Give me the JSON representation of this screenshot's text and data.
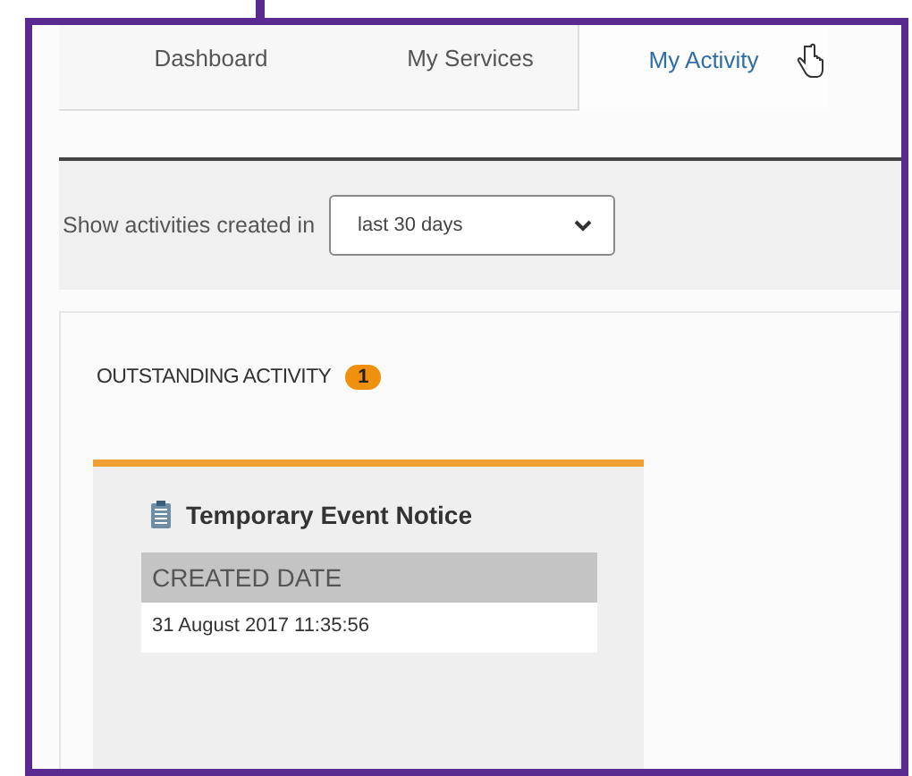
{
  "tabs": [
    {
      "label": "Dashboard",
      "selected": false
    },
    {
      "label": "My Services",
      "selected": false
    },
    {
      "label": "My Activity",
      "selected": true
    }
  ],
  "filter": {
    "label": "Show activities created in",
    "value": "last 30 days"
  },
  "section": {
    "title": "OUTSTANDING ACTIVITY",
    "count": "1"
  },
  "cards": [
    {
      "title": "Temporary Event Notice",
      "field_label": "CREATED DATE",
      "field_value": "31 August 2017 11:35:56"
    }
  ]
}
